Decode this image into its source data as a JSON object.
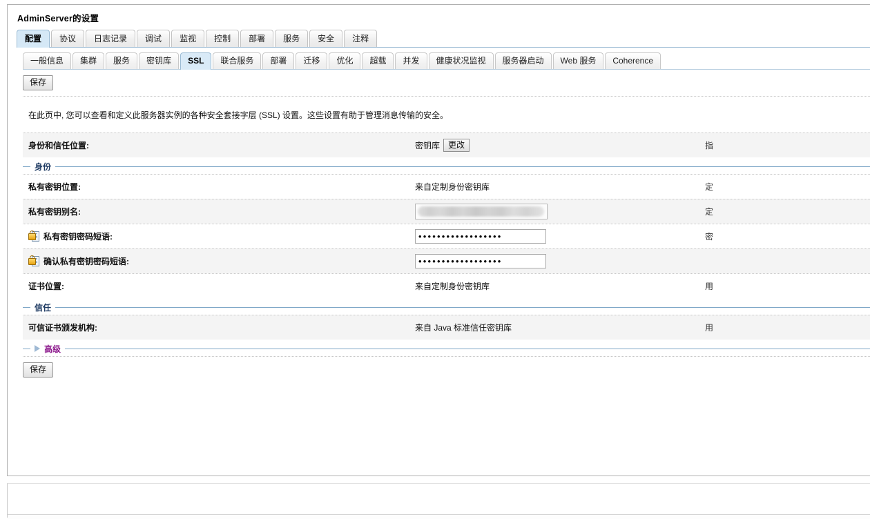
{
  "window": {
    "title": "AdminServer的设置"
  },
  "primary_tabs": [
    {
      "label": "配置",
      "active": true
    },
    {
      "label": "协议",
      "active": false
    },
    {
      "label": "日志记录",
      "active": false
    },
    {
      "label": "调试",
      "active": false
    },
    {
      "label": "监视",
      "active": false
    },
    {
      "label": "控制",
      "active": false
    },
    {
      "label": "部署",
      "active": false
    },
    {
      "label": "服务",
      "active": false
    },
    {
      "label": "安全",
      "active": false
    },
    {
      "label": "注释",
      "active": false
    }
  ],
  "secondary_tabs": [
    {
      "label": "一般信息",
      "active": false
    },
    {
      "label": "集群",
      "active": false
    },
    {
      "label": "服务",
      "active": false
    },
    {
      "label": "密钥库",
      "active": false
    },
    {
      "label": "SSL",
      "active": true
    },
    {
      "label": "联合服务",
      "active": false
    },
    {
      "label": "部署",
      "active": false
    },
    {
      "label": "迁移",
      "active": false
    },
    {
      "label": "优化",
      "active": false
    },
    {
      "label": "超载",
      "active": false
    },
    {
      "label": "并发",
      "active": false
    },
    {
      "label": "健康状况监视",
      "active": false
    },
    {
      "label": "服务器启动",
      "active": false
    },
    {
      "label": "Web 服务",
      "active": false
    },
    {
      "label": "Coherence",
      "active": false
    }
  ],
  "toolbar": {
    "save_top_label": "保存",
    "save_bottom_label": "保存"
  },
  "intro": {
    "text": "在此页中, 您可以查看和定义此服务器实例的各种安全套接字层 (SSL) 设置。这些设置有助于管理消息传输的安全。"
  },
  "form": {
    "identity_and_trust": {
      "label": "身份和信任位置:",
      "value": "密钥库",
      "change_button": "更改",
      "hint": "指"
    },
    "section_identity": "身份",
    "private_key_location": {
      "label": "私有密钥位置:",
      "value": "来自定制身份密钥库",
      "hint": "定"
    },
    "private_key_alias": {
      "label": "私有密钥别名:",
      "value": "",
      "hint": "定"
    },
    "private_key_passphrase": {
      "label": "私有密钥密码短语:",
      "value": "••••••••••••••••••",
      "hint": "密"
    },
    "confirm_private_key_passphrase": {
      "label": "确认私有密钥密码短语:",
      "value": "••••••••••••••••••",
      "hint": ""
    },
    "certificate_location": {
      "label": "证书位置:",
      "value": "来自定制身份密钥库",
      "hint": "用"
    },
    "section_trust": "信任",
    "trusted_cert_authorities": {
      "label": "可信证书颁发机构:",
      "value": "来自 Java 标准信任密钥库",
      "hint": "用"
    },
    "section_advanced": "高级"
  },
  "colors": {
    "active_tab_bg": "#d5e8f6",
    "section_title": "#1f3b63",
    "advanced_link": "#8d1b8d",
    "rule": "#7fa7c8",
    "row_alt_bg": "#f4f4f4"
  },
  "icons": {
    "lock": "lock-icon",
    "expand_triangle": "triangle-right-icon"
  }
}
